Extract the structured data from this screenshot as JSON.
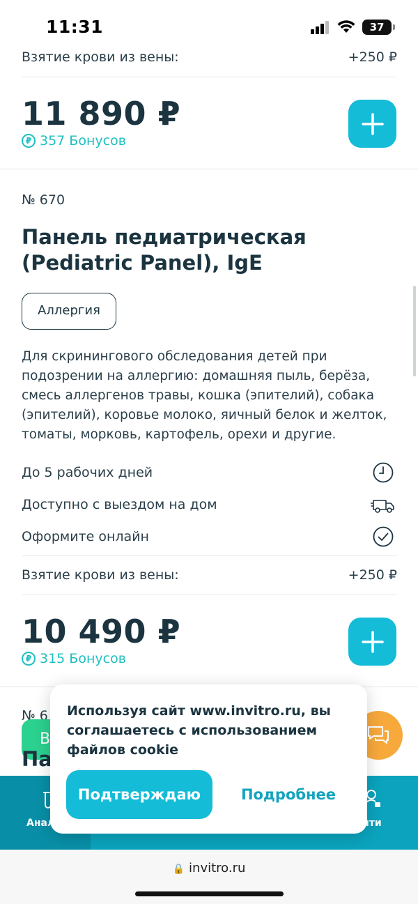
{
  "status_bar": {
    "time": "11:31",
    "battery": "37"
  },
  "prev_item": {
    "blood_draw_label": "Взятие крови из вены:",
    "blood_draw_price": "+250 ₽",
    "price": "11 890 ₽",
    "bonus": "357 Бонусов"
  },
  "item": {
    "number": "№ 670",
    "title": "Панель педиатрическая (Pediatric Panel), IgE",
    "tag": "Аллергия",
    "description": "Для скринингового обследования детей при подозрении на аллергию: домашняя пыль, берёза, смесь аллергенов травы, кошка (эпителий), собака (эпителий), коровье молоко, яичный белок и желток, томаты, морковь, картофель, орехи и другие.",
    "features": [
      {
        "label": "До 5 рабочих дней",
        "icon": "clock-icon"
      },
      {
        "label": "Доступно с выездом на дом",
        "icon": "delivery-van-icon"
      },
      {
        "label": "Оформите онлайн",
        "icon": "check-circle-icon"
      }
    ],
    "blood_draw_label": "Взятие крови из вены:",
    "blood_draw_price": "+250 ₽",
    "price": "10 490 ₽",
    "bonus": "315 Бонусов"
  },
  "next_item": {
    "number_partial": "№ 6",
    "title_partial": "Па",
    "button_partial": "В"
  },
  "bottom_nav": {
    "left_label": "Анал",
    "right_label": "йти"
  },
  "cookie": {
    "text": "Используя сайт www.invitro.ru, вы соглашаетесь с использованием файлов cookie",
    "accept": "Подтверждаю",
    "more": "Подробнее"
  },
  "browser": {
    "url": "invitro.ru"
  },
  "colors": {
    "accent": "#14bcd8",
    "bonus": "#1fc0c0",
    "text": "#1b3440",
    "nav": "#0ba3bd",
    "chat": "#f7a93c",
    "green": "#2bd18e"
  }
}
